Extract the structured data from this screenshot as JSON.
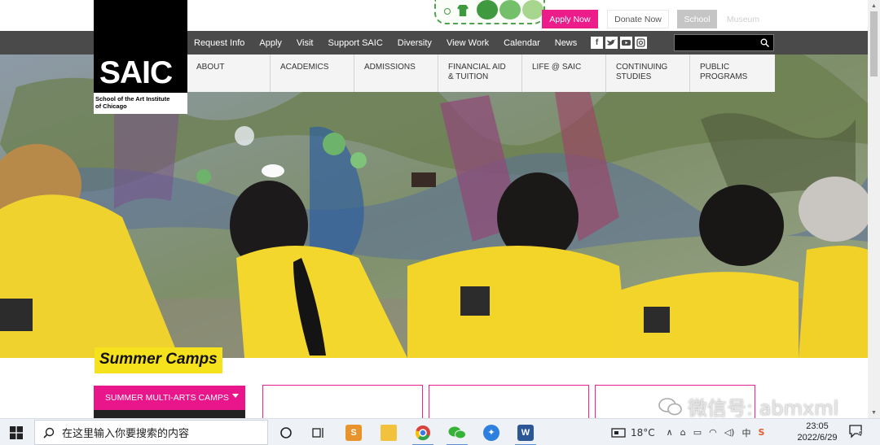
{
  "utility": {
    "apply_now": "Apply Now",
    "donate_now": "Donate Now",
    "school": "School",
    "museum": "Museum"
  },
  "nav": {
    "links": [
      "Request Info",
      "Apply",
      "Visit",
      "Support SAIC",
      "Diversity",
      "View Work",
      "Calendar",
      "News"
    ],
    "search_placeholder": ""
  },
  "logo": {
    "mark": "SAIC",
    "line1": "School of the Art Institute",
    "line2": "of Chicago"
  },
  "mega_menu": [
    {
      "line1": "ABOUT",
      "line2": ""
    },
    {
      "line1": "ACADEMICS",
      "line2": ""
    },
    {
      "line1": "ADMISSIONS",
      "line2": ""
    },
    {
      "line1": "FINANCIAL AID",
      "line2": "& TUITION"
    },
    {
      "line1": "LIFE @ SAIC",
      "line2": ""
    },
    {
      "line1": "CONTINUING",
      "line2": "STUDIES"
    },
    {
      "line1": "PUBLIC PROGRAMS",
      "line2": ""
    }
  ],
  "section": {
    "title": "Summer Camps",
    "camp_select": "SUMMER MULTI-ARTS CAMPS"
  },
  "watermark": "微信号: abmxml",
  "taskbar": {
    "search_text": "在这里输入你要搜索的内容",
    "temperature": "18°C",
    "ime_label": "中",
    "time": "23:05",
    "date": "2022/6/29",
    "notifications": "4"
  },
  "colors": {
    "accent_pink": "#ec1c8b",
    "nav_gray": "#4a4a4a",
    "summer_yellow": "#f5e11c"
  }
}
